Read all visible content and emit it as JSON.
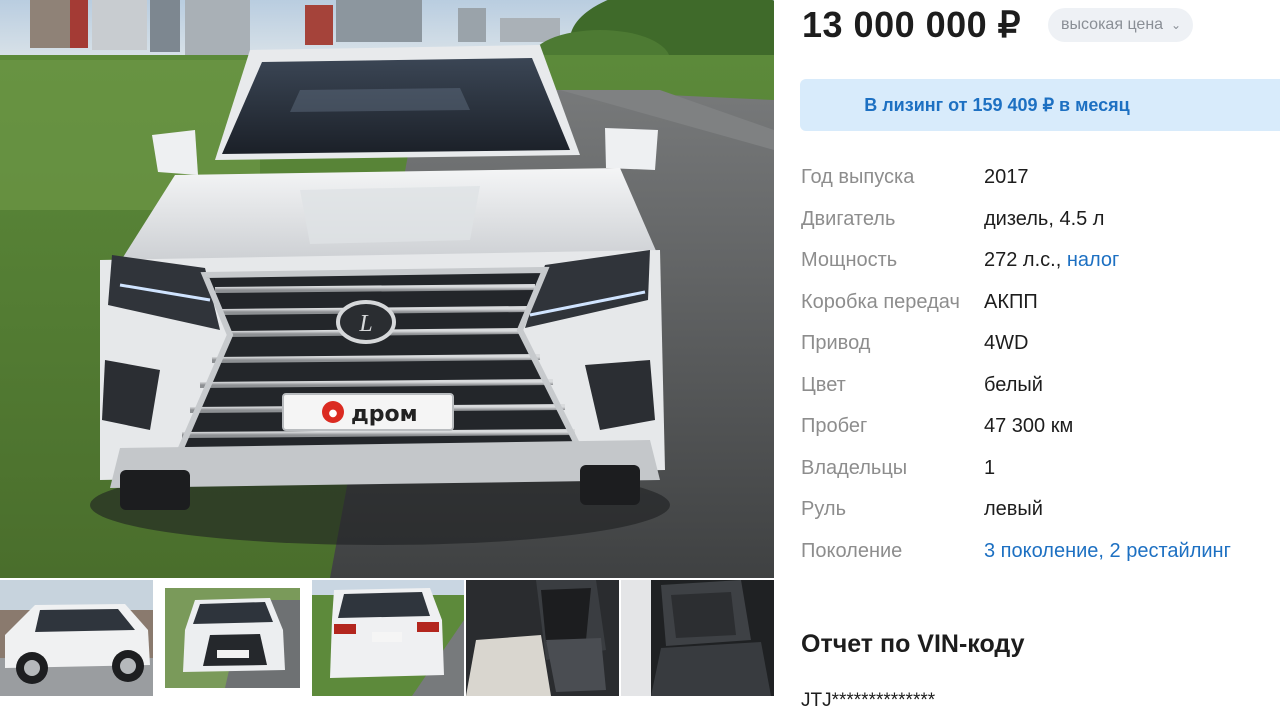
{
  "listing": {
    "price": "13 000 000 ₽",
    "price_badge": "высокая цена",
    "leasing": "В лизинг от 159 409 ₽ в месяц",
    "watermark": "дром"
  },
  "specs": [
    {
      "label": "Год выпуска",
      "value": "2017"
    },
    {
      "label": "Двигатель",
      "value": "дизель, 4.5 л"
    },
    {
      "label": "Мощность",
      "value": "272 л.с.,",
      "link": "налог"
    },
    {
      "label": "Коробка передач",
      "value": "АКПП"
    },
    {
      "label": "Привод",
      "value": "4WD"
    },
    {
      "label": "Цвет",
      "value": "белый"
    },
    {
      "label": "Пробег",
      "value": "47 300 км"
    },
    {
      "label": "Владельцы",
      "value": "1"
    },
    {
      "label": "Руль",
      "value": "левый"
    },
    {
      "label": "Поколение",
      "link": "3 поколение, 2 рестайлинг"
    }
  ],
  "vin": {
    "title": "Отчет по VIN-коду",
    "code": "JTJ**************"
  },
  "colors": {
    "link": "#1d70c2",
    "leasing_bg": "#d8ebfb",
    "badge_bg": "#eef1f5",
    "label": "#8d8d8d"
  },
  "icons": {
    "badge": "chevron-down-icon",
    "watermark_logo": "drom-logo-icon"
  }
}
